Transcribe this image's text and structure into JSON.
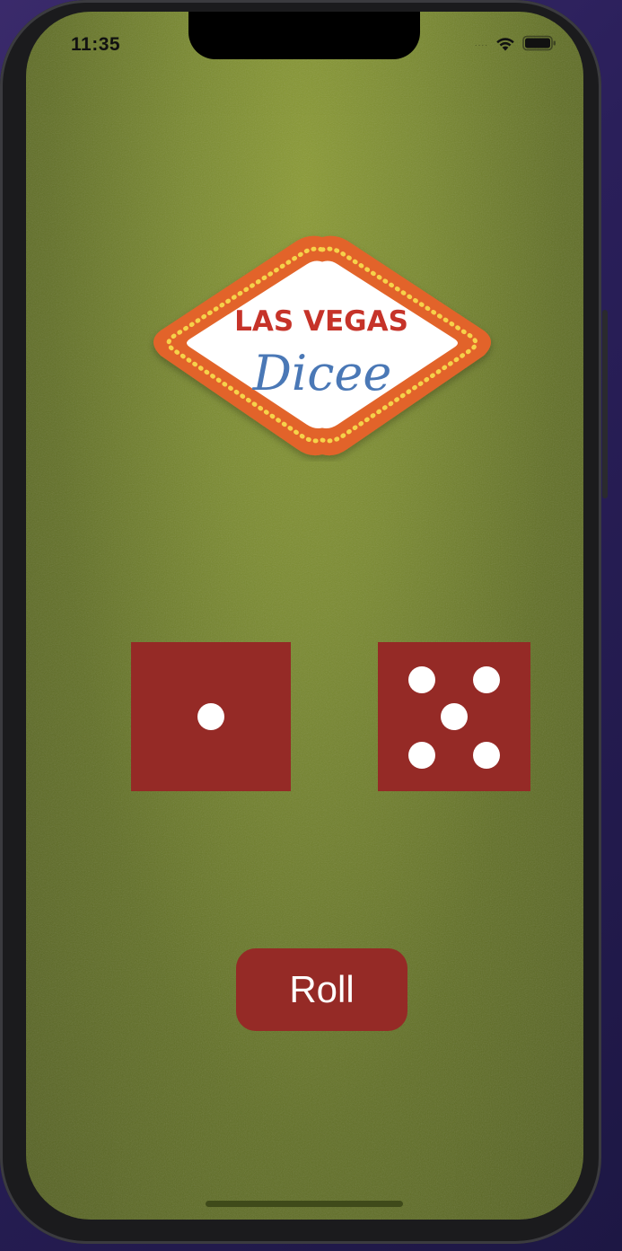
{
  "status_bar": {
    "time": "11:35",
    "signal": "....",
    "wifi_icon": "wifi-icon",
    "battery_icon": "battery-icon"
  },
  "logo": {
    "top_text": "LAS VEGAS",
    "script_text": "Dicee",
    "colors": {
      "border_orange": "#e2642a",
      "bulb_yellow": "#f6d24a",
      "inner_white": "#ffffff",
      "top_text_red": "#c63329",
      "script_blue": "#4a78b6"
    }
  },
  "dice": {
    "left": {
      "value": 1
    },
    "right": {
      "value": 5
    },
    "color": "#952a26",
    "pip_color": "#ffffff"
  },
  "roll_button": {
    "label": "Roll",
    "color": "#952a26"
  },
  "colors": {
    "felt_green": "#7a8a30"
  }
}
